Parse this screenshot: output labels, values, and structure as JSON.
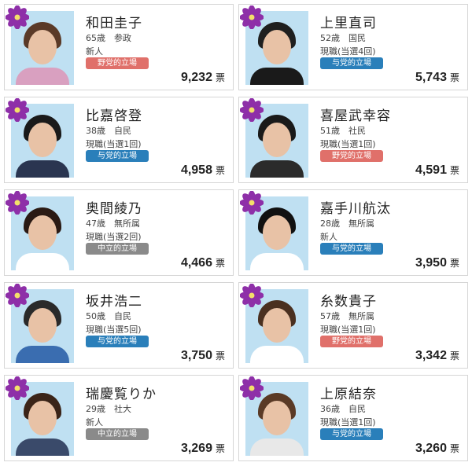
{
  "colors": {
    "opposition_badge": "#e0706a",
    "ruling_badge": "#2a7fba",
    "neutral_badge": "#8a8a8a",
    "flower": "#8e2fa8",
    "photo_background": "#bfe0f2"
  },
  "vote_unit": "票",
  "candidates": [
    {
      "name": "和田圭子",
      "age_party": "65歳　参政",
      "status": "新人",
      "stance": "野党的立場",
      "stance_type": "opposition",
      "votes": "9,232",
      "hair": "#5a3a28",
      "clothes": "#d9a0c0"
    },
    {
      "name": "上里直司",
      "age_party": "52歳　国民",
      "status": "現職(当選4回)",
      "stance": "与党的立場",
      "stance_type": "ruling",
      "votes": "5,743",
      "hair": "#1f1f1f",
      "clothes": "#1a1a1a"
    },
    {
      "name": "比嘉啓登",
      "age_party": "38歳　自民",
      "status": "現職(当選1回)",
      "stance": "与党的立場",
      "stance_type": "ruling",
      "votes": "4,958",
      "hair": "#1a1a1a",
      "clothes": "#2a3550"
    },
    {
      "name": "喜屋武幸容",
      "age_party": "51歳　社民",
      "status": "現職(当選1回)",
      "stance": "野党的立場",
      "stance_type": "opposition",
      "votes": "4,591",
      "hair": "#1a1a1a",
      "clothes": "#2b2b2b"
    },
    {
      "name": "奥間綾乃",
      "age_party": "47歳　無所属",
      "status": "現職(当選2回)",
      "stance": "中立的立場",
      "stance_type": "neutral",
      "votes": "4,466",
      "hair": "#2a1a14",
      "clothes": "#ffffff"
    },
    {
      "name": "嘉手川航汰",
      "age_party": "28歳　無所属",
      "status": "新人",
      "stance": "与党的立場",
      "stance_type": "ruling",
      "votes": "3,950",
      "hair": "#111111",
      "clothes": "#ffffff"
    },
    {
      "name": "坂井浩二",
      "age_party": "50歳　自民",
      "status": "現職(当選5回)",
      "stance": "与党的立場",
      "stance_type": "ruling",
      "votes": "3,750",
      "hair": "#2a2a2a",
      "clothes": "#3a6db0"
    },
    {
      "name": "糸数貴子",
      "age_party": "57歳　無所属",
      "status": "現職(当選1回)",
      "stance": "野党的立場",
      "stance_type": "opposition",
      "votes": "3,342",
      "hair": "#4a3020",
      "clothes": "#ffffff"
    },
    {
      "name": "瑞慶覧りか",
      "age_party": "29歳　社大",
      "status": "新人",
      "stance": "中立的立場",
      "stance_type": "neutral",
      "votes": "3,269",
      "hair": "#3a2418",
      "clothes": "#3a4a6a"
    },
    {
      "name": "上原結奈",
      "age_party": "36歳　自民",
      "status": "現職(当選1回)",
      "stance": "与党的立場",
      "stance_type": "ruling",
      "votes": "3,260",
      "hair": "#5a3a26",
      "clothes": "#e8e8e8"
    }
  ]
}
